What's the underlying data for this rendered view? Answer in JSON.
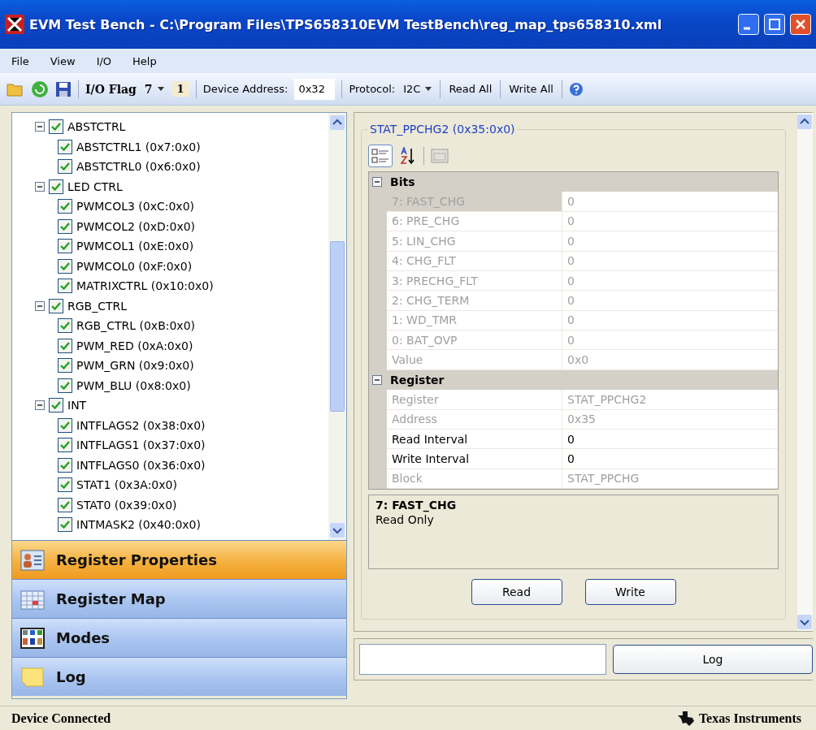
{
  "window": {
    "title": "EVM Test Bench - C:\\Program Files\\TPS658310EVM TestBench\\reg_map_tps658310.xml"
  },
  "menu": [
    "File",
    "View",
    "I/O",
    "Help"
  ],
  "toolbar": {
    "io_flag_label": "I/O Flag",
    "io_flag_value": "7",
    "io_flag_count": "1",
    "device_address_label": "Device Address:",
    "device_address": "0x32",
    "protocol_label": "Protocol:",
    "protocol": "I2C",
    "read_all": "Read All",
    "write_all": "Write All"
  },
  "tree": [
    {
      "label": "ABSTCTRL",
      "checked": true,
      "expanded": true,
      "children": [
        {
          "label": "ABSTCTRL1 (0x7:0x0)",
          "checked": true
        },
        {
          "label": "ABSTCTRL0 (0x6:0x0)",
          "checked": true
        }
      ]
    },
    {
      "label": "LED CTRL",
      "checked": true,
      "expanded": true,
      "children": [
        {
          "label": "PWMCOL3 (0xC:0x0)",
          "checked": true
        },
        {
          "label": "PWMCOL2 (0xD:0x0)",
          "checked": true
        },
        {
          "label": "PWMCOL1 (0xE:0x0)",
          "checked": true
        },
        {
          "label": "PWMCOL0 (0xF:0x0)",
          "checked": true
        },
        {
          "label": "MATRIXCTRL (0x10:0x0)",
          "checked": true
        }
      ]
    },
    {
      "label": "RGB_CTRL",
      "checked": true,
      "expanded": true,
      "children": [
        {
          "label": "RGB_CTRL (0xB:0x0)",
          "checked": true
        },
        {
          "label": "PWM_RED (0xA:0x0)",
          "checked": true
        },
        {
          "label": "PWM_GRN (0x9:0x0)",
          "checked": true
        },
        {
          "label": "PWM_BLU (0x8:0x0)",
          "checked": true
        }
      ]
    },
    {
      "label": "INT",
      "checked": true,
      "expanded": true,
      "children": [
        {
          "label": "INTFLAGS2 (0x38:0x0)",
          "checked": true
        },
        {
          "label": "INTFLAGS1 (0x37:0x0)",
          "checked": true
        },
        {
          "label": "INTFLAGS0 (0x36:0x0)",
          "checked": true
        },
        {
          "label": "STAT1 (0x3A:0x0)",
          "checked": true
        },
        {
          "label": "STAT0 (0x39:0x0)",
          "checked": true
        },
        {
          "label": "INTMASK2 (0x40:0x0)",
          "checked": true
        }
      ]
    }
  ],
  "nav": [
    {
      "label": "Register Properties",
      "selected": true
    },
    {
      "label": "Register Map",
      "selected": false
    },
    {
      "label": "Modes",
      "selected": false
    },
    {
      "label": "Log",
      "selected": false
    }
  ],
  "register_panel": {
    "title": "STAT_PPCHG2 (0x35:0x0)",
    "categories": [
      {
        "name": "Bits",
        "expanded": true,
        "rows": [
          {
            "label": "7: FAST_CHG",
            "value": "0",
            "enabled": false,
            "selected": true
          },
          {
            "label": "6: PRE_CHG",
            "value": "0",
            "enabled": false,
            "selected": false
          },
          {
            "label": "5: LIN_CHG",
            "value": "0",
            "enabled": false,
            "selected": false
          },
          {
            "label": "4: CHG_FLT",
            "value": "0",
            "enabled": false,
            "selected": false
          },
          {
            "label": "3: PRECHG_FLT",
            "value": "0",
            "enabled": false,
            "selected": false
          },
          {
            "label": "2: CHG_TERM",
            "value": "0",
            "enabled": false,
            "selected": false
          },
          {
            "label": "1: WD_TMR",
            "value": "0",
            "enabled": false,
            "selected": false
          },
          {
            "label": "0: BAT_OVP",
            "value": "0",
            "enabled": false,
            "selected": false
          },
          {
            "label": "Value",
            "value": "0x0",
            "enabled": false,
            "selected": false
          }
        ]
      },
      {
        "name": "Register",
        "expanded": true,
        "rows": [
          {
            "label": "Register",
            "value": "STAT_PPCHG2",
            "enabled": false,
            "selected": false
          },
          {
            "label": "Address",
            "value": "0x35",
            "enabled": false,
            "selected": false
          },
          {
            "label": "Read Interval",
            "value": "0",
            "enabled": true,
            "selected": false
          },
          {
            "label": "Write Interval",
            "value": "0",
            "enabled": true,
            "selected": false
          },
          {
            "label": "Block",
            "value": "STAT_PPCHG",
            "enabled": false,
            "selected": false
          }
        ]
      }
    ],
    "description_title": "7: FAST_CHG",
    "description_text": "Read Only",
    "buttons": [
      "Read",
      "Write"
    ]
  },
  "log_button": "Log",
  "status_bar": {
    "text": "Device Connected",
    "brand": "Texas Instruments"
  }
}
